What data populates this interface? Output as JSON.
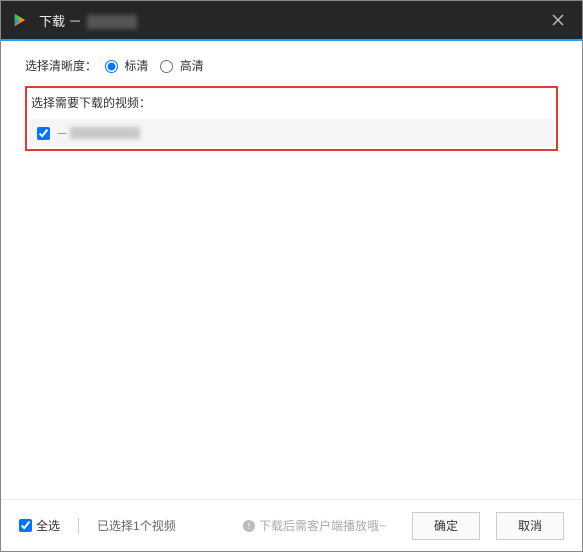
{
  "titlebar": {
    "title_prefix": "下载 －"
  },
  "quality": {
    "label": "选择清晰度：",
    "option_sd": "标清",
    "option_hd": "高清",
    "selected": "sd"
  },
  "list": {
    "heading": "选择需要下载的视频：",
    "items": [
      {
        "checked": true
      }
    ]
  },
  "footer": {
    "select_all_label": "全选",
    "select_all_checked": true,
    "count_text": "已选择1个视频",
    "hint_text": "下载后需客户端播放哦~",
    "confirm_label": "确定",
    "cancel_label": "取消"
  }
}
